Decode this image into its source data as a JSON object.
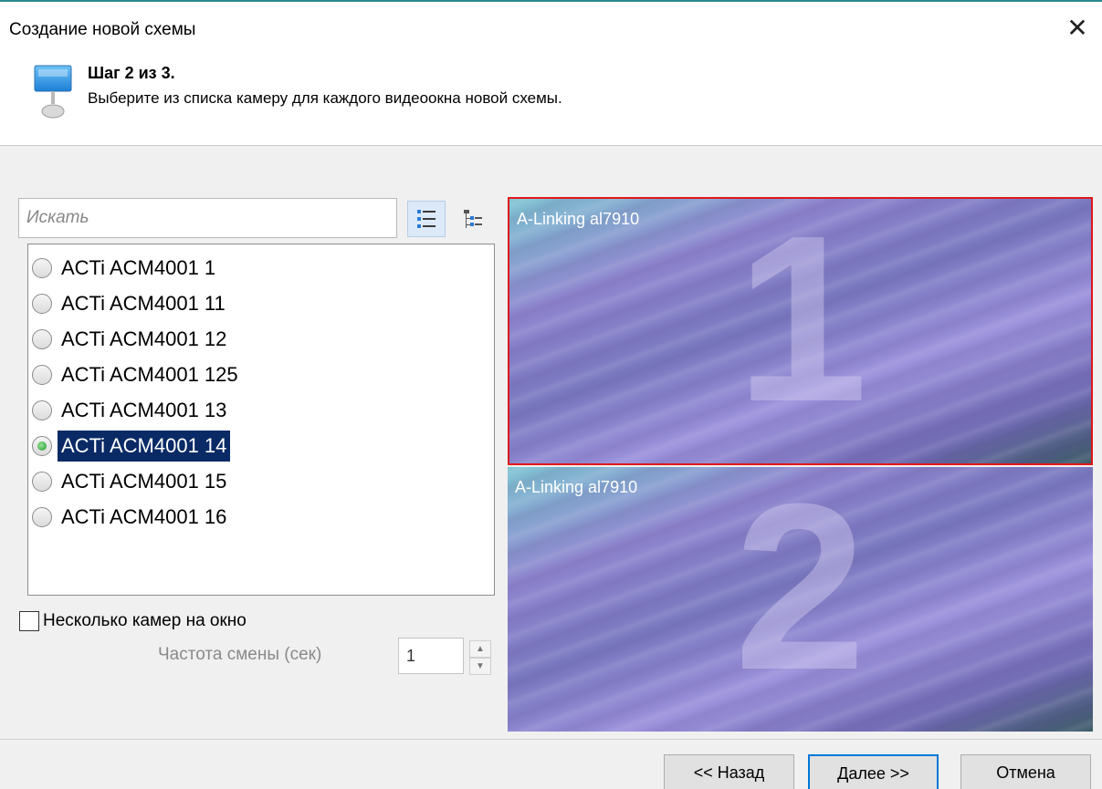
{
  "window": {
    "title": "Создание новой схемы",
    "close_symbol": "✕"
  },
  "header": {
    "icon": "monitor-icon",
    "step_title": "Шаг 2 из 3.",
    "step_description": "Выберите из списка камеру для каждого видеоокна новой схемы."
  },
  "search": {
    "placeholder": "Искать",
    "value": ""
  },
  "view_toggle": {
    "list_icon": "list-view-icon",
    "tree_icon": "tree-view-icon",
    "active": "list"
  },
  "cameras": [
    {
      "label": "ACTi ACM4001 1",
      "selected": false
    },
    {
      "label": "ACTi ACM4001 11",
      "selected": false
    },
    {
      "label": "ACTi ACM4001 12",
      "selected": false
    },
    {
      "label": "ACTi ACM4001 125",
      "selected": false
    },
    {
      "label": "ACTi ACM4001 13",
      "selected": false
    },
    {
      "label": "ACTi ACM4001 14",
      "selected": true
    },
    {
      "label": "ACTi ACM4001 15",
      "selected": false
    },
    {
      "label": "ACTi ACM4001 16",
      "selected": false
    }
  ],
  "multi_camera": {
    "label": "Несколько камер на окно",
    "checked": false
  },
  "frequency": {
    "label": "Частота смены (сек)",
    "value": "1",
    "enabled": false
  },
  "preview": {
    "tiles": [
      {
        "number": "1",
        "camera": "A-Linking al7910",
        "active": true
      },
      {
        "number": "2",
        "camera": "A-Linking al7910",
        "active": false
      }
    ],
    "active_border_color": "#e01818"
  },
  "footer": {
    "back_label": "<< Назад",
    "next_label": "Далее >>",
    "cancel_label": "Отмена"
  }
}
